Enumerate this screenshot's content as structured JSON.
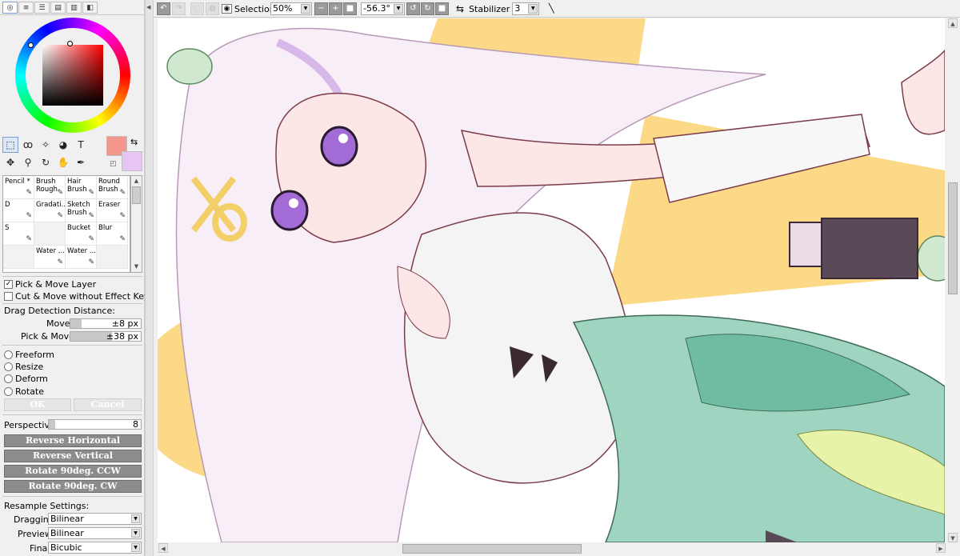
{
  "app": {
    "panel_tabs": [
      "◎",
      "≡",
      "☰",
      "▤",
      "▥",
      "◧"
    ]
  },
  "colors": {
    "foreground": "#f5968c",
    "background": "#e6c4f4"
  },
  "tools": [
    {
      "name": "rect-select-icon",
      "glyph": "⬚"
    },
    {
      "name": "lasso-icon",
      "glyph": "ꝏ"
    },
    {
      "name": "magic-wand-icon",
      "glyph": "✧"
    },
    {
      "name": "fill-shape-icon",
      "glyph": "◕"
    },
    {
      "name": "text-icon",
      "glyph": "T"
    },
    {
      "name": "move-icon",
      "glyph": "✥"
    },
    {
      "name": "zoom-icon",
      "glyph": "⚲"
    },
    {
      "name": "rotate-icon",
      "glyph": "↻"
    },
    {
      "name": "hand-icon",
      "glyph": "✋"
    },
    {
      "name": "eyedropper-icon",
      "glyph": "✒"
    }
  ],
  "brushes": [
    {
      "label": "Pencil *",
      "col": 0,
      "row": 0
    },
    {
      "label": "Brush\nRough",
      "col": 1,
      "row": 0
    },
    {
      "label": "Hair\nBrush",
      "col": 2,
      "row": 0
    },
    {
      "label": "Round\nBrush",
      "col": 3,
      "row": 0
    },
    {
      "label": "D",
      "col": 0,
      "row": 1
    },
    {
      "label": "Gradati...",
      "col": 1,
      "row": 1
    },
    {
      "label": "Sketch\nBrush",
      "col": 2,
      "row": 1
    },
    {
      "label": "Eraser",
      "col": 3,
      "row": 1
    },
    {
      "label": "S",
      "col": 0,
      "row": 2
    },
    {
      "label": "",
      "col": 1,
      "row": 2
    },
    {
      "label": "Bucket",
      "col": 2,
      "row": 2
    },
    {
      "label": "Blur",
      "col": 3,
      "row": 2
    },
    {
      "label": "",
      "col": 0,
      "row": 3
    },
    {
      "label": "Water ...",
      "col": 1,
      "row": 3
    },
    {
      "label": "Water ...",
      "col": 2,
      "row": 3
    },
    {
      "label": "",
      "col": 3,
      "row": 3
    }
  ],
  "options": {
    "pick_move_layer": "Pick & Move Layer",
    "pick_move_checked": "✓",
    "cut_move": "Cut & Move without Effect Key",
    "drag_detection": "Drag Detection Distance:",
    "move_label": "Move",
    "move_value": "±8 px",
    "pickmove_label": "Pick & Move",
    "pickmove_value": "±38 px",
    "freeform": "Freeform",
    "resize": "Resize",
    "deform": "Deform",
    "rotate": "Rotate",
    "ok": "OK",
    "cancel": "Cancel",
    "perspective_label": "Perspective",
    "perspective_value": "8",
    "reverse_h": "Reverse Horizontal",
    "reverse_v": "Reverse Vertical",
    "rotate_ccw": "Rotate 90deg. CCW",
    "rotate_cw": "Rotate 90deg. CW",
    "resample": "Resample Settings:",
    "dragging_label": "Dragging",
    "dragging_value": "Bilinear",
    "preview_label": "Preview",
    "preview_value": "Bilinear",
    "final_label": "Final",
    "final_value": "Bicubic"
  },
  "toolbar": {
    "selection_label": "Selection",
    "zoom": "50%",
    "angle": "-56.3°",
    "stabilizer_label": "Stabilizer",
    "stabilizer_value": "3"
  }
}
